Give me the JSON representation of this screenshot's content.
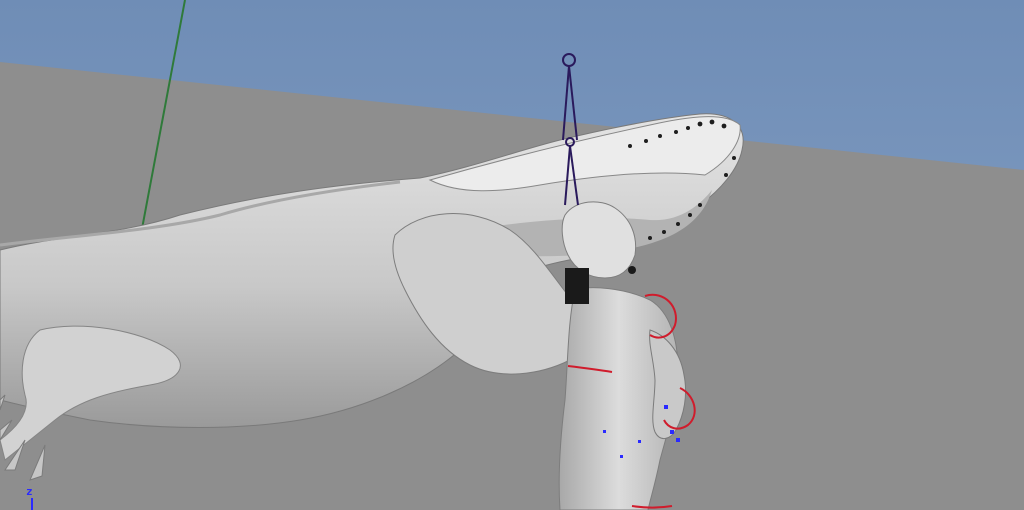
{
  "viewport": {
    "colors": {
      "sky": "#7f9bbf",
      "ground": "#8e8e8e",
      "mesh_light": "#d9d9d9",
      "mesh_mid": "#bdbdbd",
      "mesh_dark": "#8a8a8a",
      "joint_wire": "#2a1a5c",
      "ik_handle_red": "#d01c2c",
      "axis_green": "#2f7a3a",
      "manip_blue": "#2a2aff"
    },
    "axis_indicator_label": "z"
  }
}
